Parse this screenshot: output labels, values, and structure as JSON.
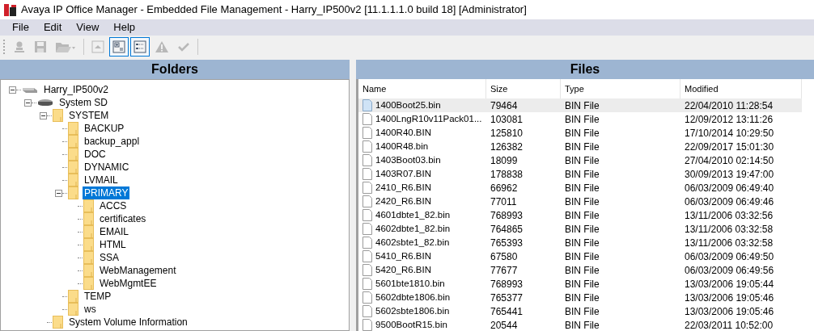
{
  "window": {
    "title": "Avaya IP Office Manager - Embedded File Management - Harry_IP500v2 [11.1.1.1.0 build 18] [Administrator]"
  },
  "menu": [
    "File",
    "Edit",
    "View",
    "Help"
  ],
  "toolbar": [
    {
      "kind": "connect",
      "disabled": true,
      "checked": false
    },
    {
      "kind": "save",
      "disabled": true,
      "checked": false
    },
    {
      "kind": "open",
      "disabled": true,
      "checked": false
    },
    {
      "kind": "separator"
    },
    {
      "kind": "up",
      "disabled": true,
      "checked": false
    },
    {
      "kind": "tree",
      "disabled": false,
      "checked": true
    },
    {
      "kind": "list",
      "disabled": false,
      "checked": true
    },
    {
      "kind": "warning",
      "disabled": true,
      "checked": false
    },
    {
      "kind": "check",
      "disabled": true,
      "checked": false
    },
    {
      "kind": "separator"
    }
  ],
  "folders": {
    "title": "Folders",
    "tree": [
      {
        "label": "Harry_IP500v2",
        "kind": "server",
        "expanded": true,
        "selected": false,
        "children": [
          {
            "label": "System SD",
            "kind": "drive",
            "expanded": true,
            "selected": false,
            "children": [
              {
                "label": "SYSTEM",
                "kind": "folder",
                "expanded": true,
                "selected": false,
                "children": [
                  {
                    "label": "BACKUP",
                    "kind": "folder",
                    "selected": false
                  },
                  {
                    "label": "backup_appl",
                    "kind": "folder",
                    "selected": false
                  },
                  {
                    "label": "DOC",
                    "kind": "folder",
                    "selected": false
                  },
                  {
                    "label": "DYNAMIC",
                    "kind": "folder",
                    "selected": false
                  },
                  {
                    "label": "LVMAIL",
                    "kind": "folder",
                    "selected": false
                  },
                  {
                    "label": "PRIMARY",
                    "kind": "folder",
                    "expanded": true,
                    "selected": true,
                    "children": [
                      {
                        "label": "ACCS",
                        "kind": "folder",
                        "selected": false
                      },
                      {
                        "label": "certificates",
                        "kind": "folder",
                        "selected": false
                      },
                      {
                        "label": "EMAIL",
                        "kind": "folder",
                        "selected": false
                      },
                      {
                        "label": "HTML",
                        "kind": "folder",
                        "selected": false
                      },
                      {
                        "label": "SSA",
                        "kind": "folder",
                        "selected": false
                      },
                      {
                        "label": "WebManagement",
                        "kind": "folder",
                        "selected": false
                      },
                      {
                        "label": "WebMgmtEE",
                        "kind": "folder",
                        "selected": false
                      }
                    ]
                  },
                  {
                    "label": "TEMP",
                    "kind": "folder",
                    "selected": false
                  },
                  {
                    "label": "ws",
                    "kind": "folder",
                    "selected": false
                  }
                ]
              },
              {
                "label": "System Volume Information",
                "kind": "folder",
                "selected": false
              }
            ]
          }
        ]
      }
    ]
  },
  "files": {
    "title": "Files",
    "columns": [
      "Name",
      "Size",
      "Type",
      "Modified"
    ],
    "rows": [
      {
        "name": "1400Boot25.bin",
        "size": "79464",
        "type": "BIN File",
        "modified": "22/04/2010 11:28:54",
        "selected": true
      },
      {
        "name": "1400LngR10v11Pack01...",
        "size": "103081",
        "type": "BIN File",
        "modified": "12/09/2012 13:11:26",
        "selected": false
      },
      {
        "name": "1400R40.BIN",
        "size": "125810",
        "type": "BIN File",
        "modified": "17/10/2014 10:29:50",
        "selected": false
      },
      {
        "name": "1400R48.bin",
        "size": "126382",
        "type": "BIN File",
        "modified": "22/09/2017 15:01:30",
        "selected": false
      },
      {
        "name": "1403Boot03.bin",
        "size": "18099",
        "type": "BIN File",
        "modified": "27/04/2010 02:14:50",
        "selected": false
      },
      {
        "name": "1403R07.BIN",
        "size": "178838",
        "type": "BIN File",
        "modified": "30/09/2013 19:47:00",
        "selected": false
      },
      {
        "name": "2410_R6.BIN",
        "size": "66962",
        "type": "BIN File",
        "modified": "06/03/2009 06:49:40",
        "selected": false
      },
      {
        "name": "2420_R6.BIN",
        "size": "77011",
        "type": "BIN File",
        "modified": "06/03/2009 06:49:46",
        "selected": false
      },
      {
        "name": "4601dbte1_82.bin",
        "size": "768993",
        "type": "BIN File",
        "modified": "13/11/2006 03:32:56",
        "selected": false
      },
      {
        "name": "4602dbte1_82.bin",
        "size": "764865",
        "type": "BIN File",
        "modified": "13/11/2006 03:32:58",
        "selected": false
      },
      {
        "name": "4602sbte1_82.bin",
        "size": "765393",
        "type": "BIN File",
        "modified": "13/11/2006 03:32:58",
        "selected": false
      },
      {
        "name": "5410_R6.BIN",
        "size": "67580",
        "type": "BIN File",
        "modified": "06/03/2009 06:49:50",
        "selected": false
      },
      {
        "name": "5420_R6.BIN",
        "size": "77677",
        "type": "BIN File",
        "modified": "06/03/2009 06:49:56",
        "selected": false
      },
      {
        "name": "5601bte1810.bin",
        "size": "768993",
        "type": "BIN File",
        "modified": "13/03/2006 19:05:44",
        "selected": false
      },
      {
        "name": "5602dbte1806.bin",
        "size": "765377",
        "type": "BIN File",
        "modified": "13/03/2006 19:05:46",
        "selected": false
      },
      {
        "name": "5602sbte1806.bin",
        "size": "765441",
        "type": "BIN File",
        "modified": "13/03/2006 19:05:46",
        "selected": false
      },
      {
        "name": "9500BootR15.bin",
        "size": "20544",
        "type": "BIN File",
        "modified": "22/03/2011 10:52:00",
        "selected": false
      }
    ]
  }
}
